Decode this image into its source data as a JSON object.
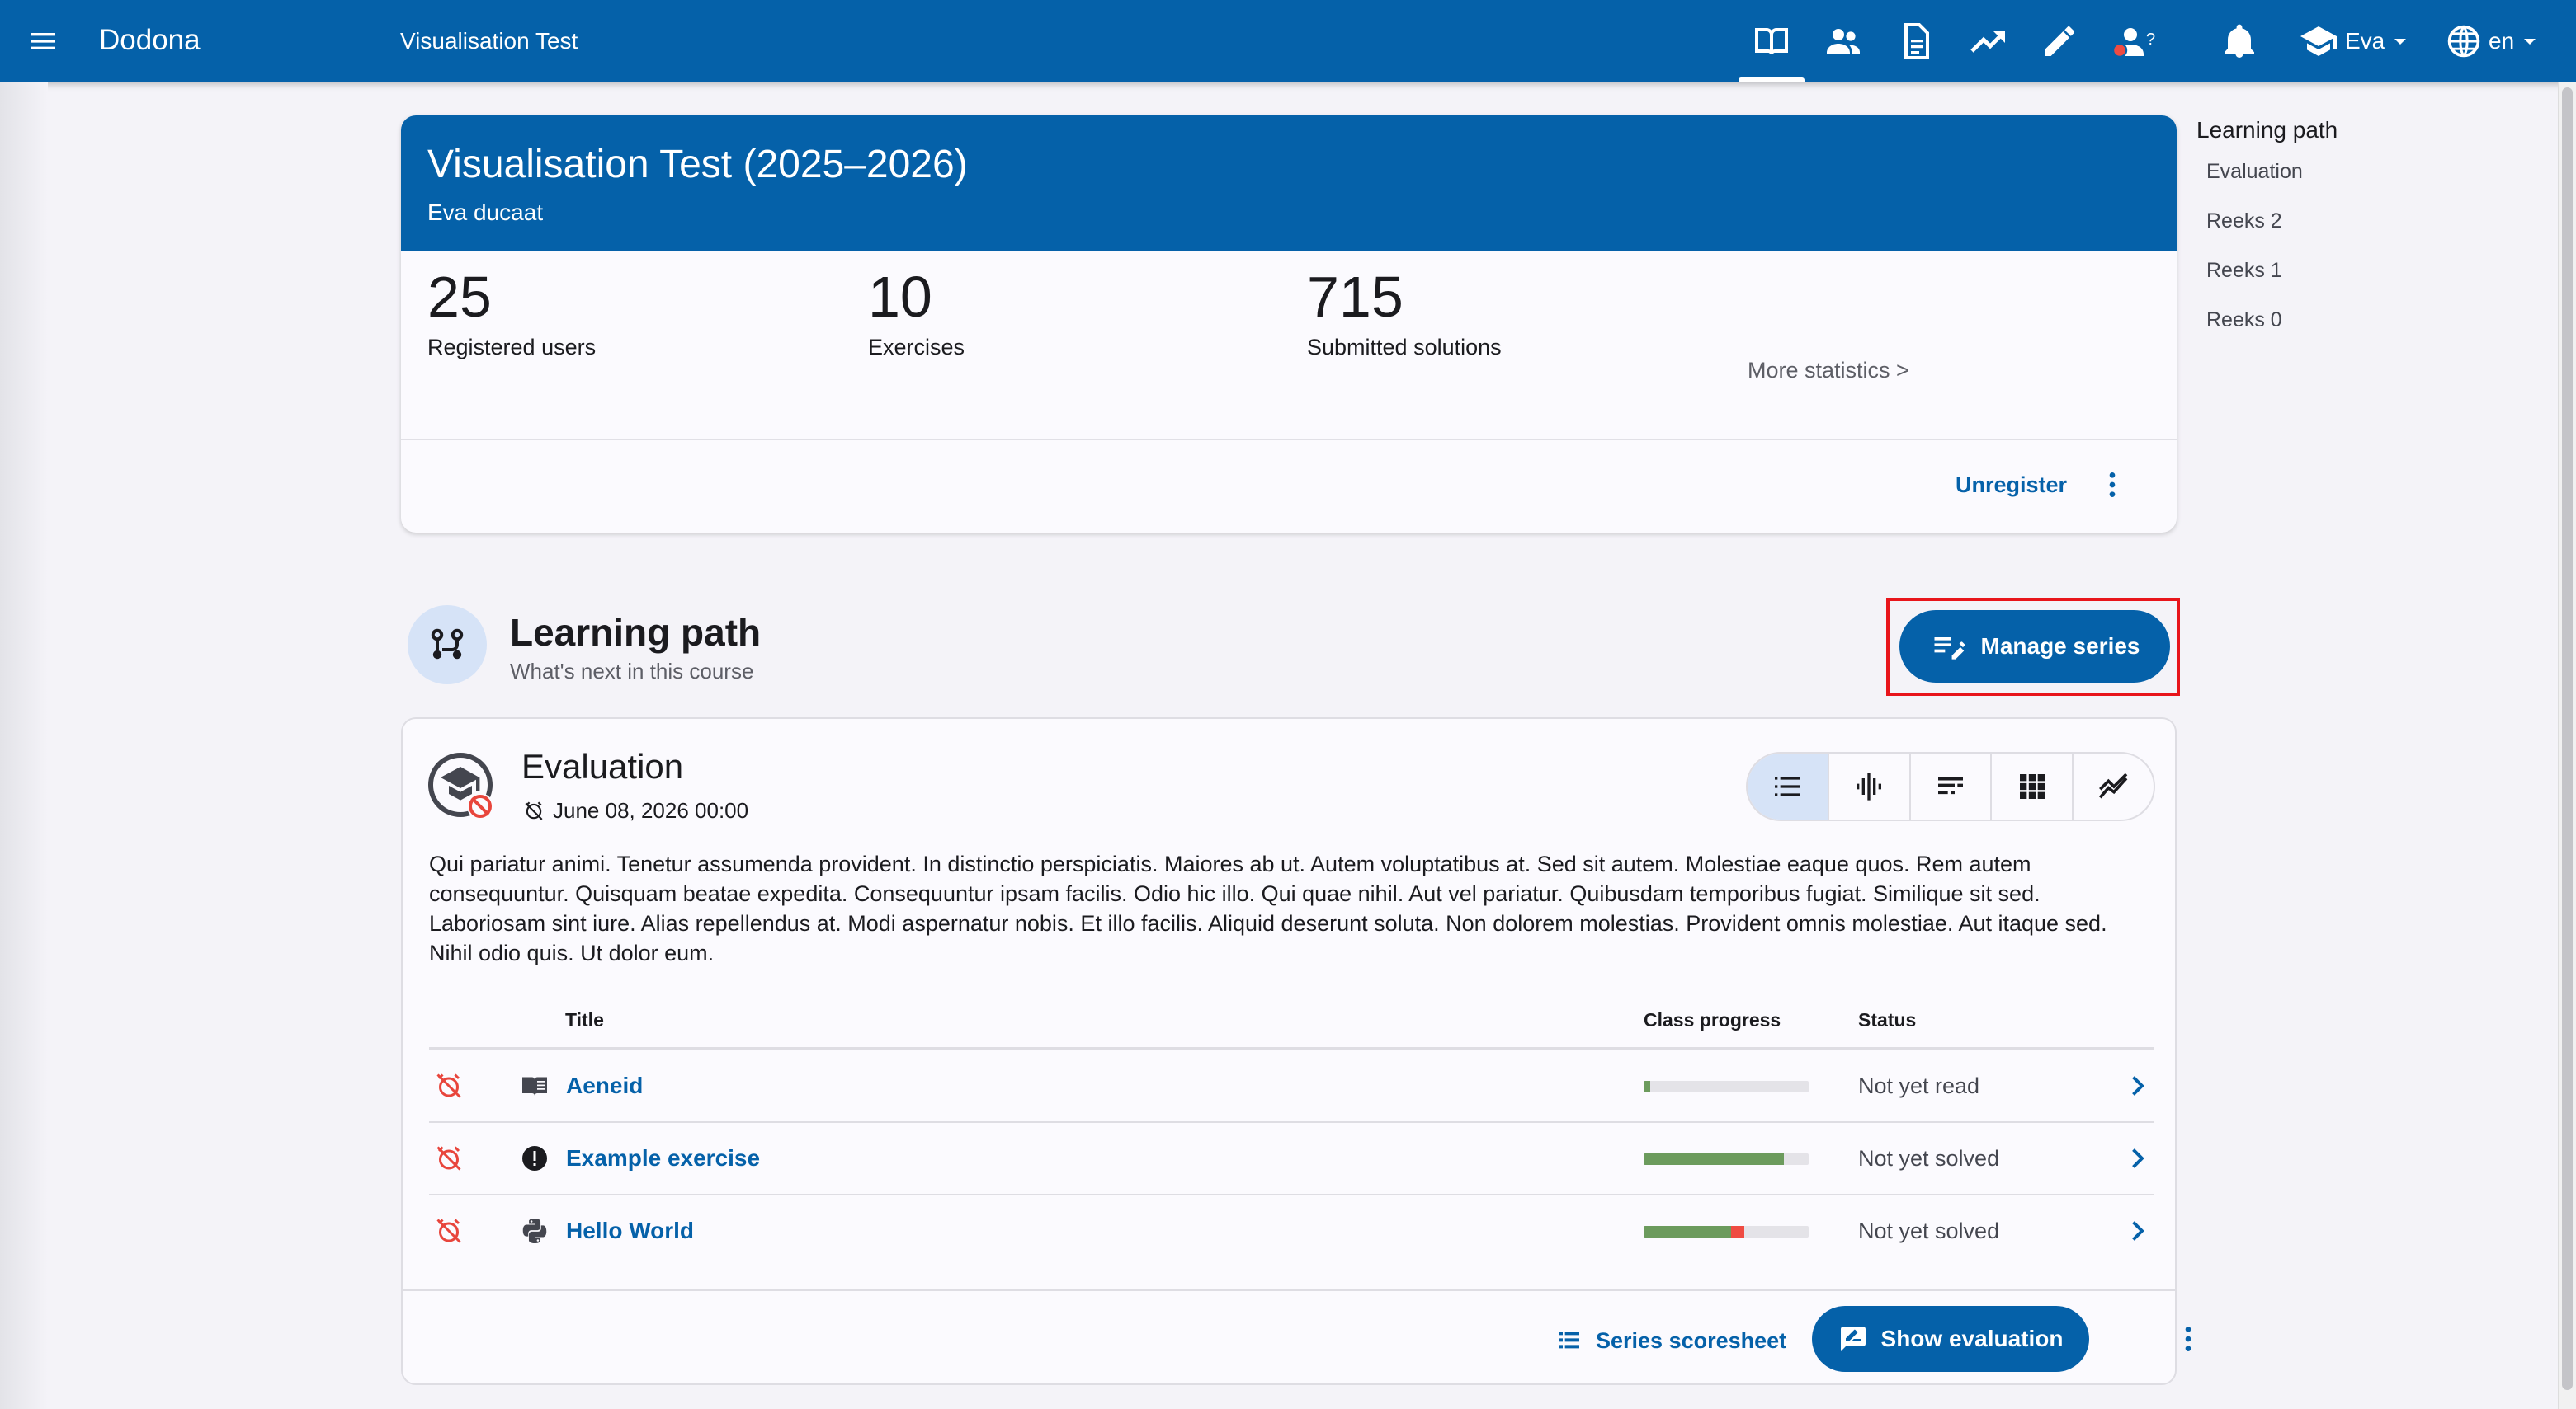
{
  "topbar": {
    "brand": "Dodona",
    "course_title": "Visualisation Test",
    "user_name": "Eva",
    "language": "en",
    "help_badge": "?",
    "icons": [
      "book-open-icon",
      "users-icon",
      "document-icon",
      "trending-up-icon",
      "pencil-icon",
      "user-question-icon",
      "bell-icon"
    ]
  },
  "course": {
    "title": "Visualisation Test (2025–2026)",
    "teacher": "Eva ducaat",
    "stats": [
      {
        "value": "25",
        "label": "Registered users"
      },
      {
        "value": "10",
        "label": "Exercises"
      },
      {
        "value": "715",
        "label": "Submitted solutions"
      }
    ],
    "more_statistics": "More statistics >",
    "unregister": "Unregister"
  },
  "toc": {
    "title": "Learning path",
    "items": [
      "Evaluation",
      "Reeks 2",
      "Reeks 1",
      "Reeks 0"
    ]
  },
  "learning_path": {
    "title": "Learning path",
    "subtitle": "What's next in this course",
    "manage_series": "Manage series"
  },
  "series": {
    "title": "Evaluation",
    "deadline": "June 08, 2026 00:00",
    "description": "Qui pariatur animi. Tenetur assumenda provident. In distinctio perspiciatis. Maiores ab ut. Autem voluptatibus at. Sed sit autem. Molestiae eaque quos. Rem autem consequuntur. Quisquam beatae expedita. Consequuntur ipsam facilis. Odio hic illo. Qui quae nihil. Aut vel pariatur. Quibusdam temporibus fugiat. Similique sit sed. Laboriosam sint iure. Alias repellendus at. Modi aspernatur nobis. Et illo facilis. Aliquid deserunt soluta. Non dolorem molestias. Provident omnis molestiae. Aut itaque sed. Nihil odio quis. Ut dolor eum.",
    "columns": {
      "title": "Title",
      "progress": "Class progress",
      "status": "Status"
    },
    "rows": [
      {
        "title": "Aeneid",
        "type_icon": "reading-book-icon",
        "status": "Not yet read",
        "progress_ok": 0.04,
        "progress_bad": 0
      },
      {
        "title": "Example exercise",
        "type_icon": "alert-circle-icon",
        "status": "Not yet solved",
        "progress_ok": 0.85,
        "progress_bad": 0
      },
      {
        "title": "Hello World",
        "type_icon": "python-icon",
        "status": "Not yet solved",
        "progress_ok": 0.53,
        "progress_bad": 0.08
      }
    ],
    "series_scoresheet": "Series scoresheet",
    "show_evaluation": "Show evaluation"
  },
  "colors": {
    "primary": "#0561a9",
    "highlight": "#e8151b",
    "progress_ok": "#6c9b5d",
    "progress_bad": "#ef4b42",
    "alarm": "#e8453c"
  }
}
